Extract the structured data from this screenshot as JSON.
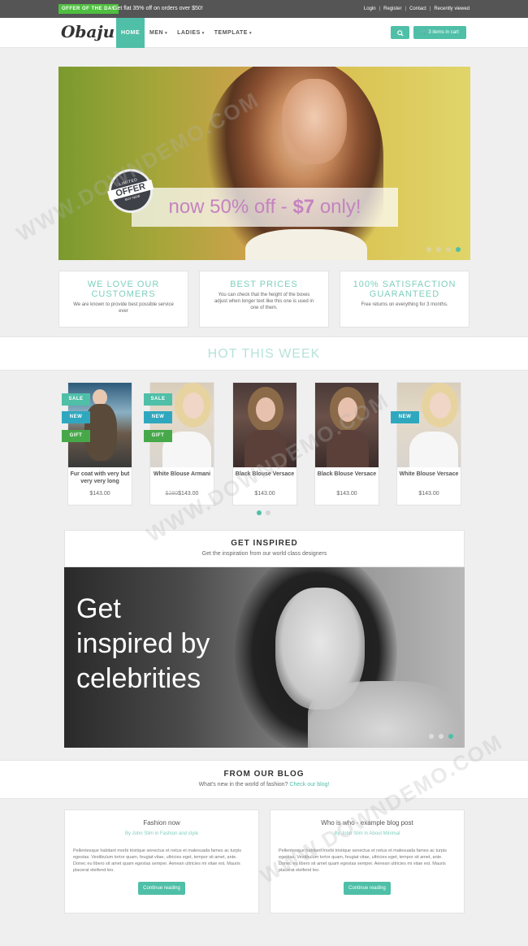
{
  "topbar": {
    "offer_badge": "OFFER OF THE DAY",
    "offer_text": "Get flat 35% off on orders over $50!",
    "links": [
      "Login",
      "Register",
      "Contact",
      "Recently viewed"
    ]
  },
  "nav": {
    "logo": "Obaju",
    "items": [
      {
        "label": "HOME",
        "caret": ""
      },
      {
        "label": "MEN",
        "caret": "▾"
      },
      {
        "label": "LADIES",
        "caret": "▾"
      },
      {
        "label": "TEMPLATE",
        "caret": "▾"
      }
    ],
    "search_icon": "🔍",
    "cart_label": "🛒 3 items in cart"
  },
  "hero": {
    "badge_top": "LIMITED",
    "badge_mid": "OFFER",
    "badge_bottom": "BUY NOW",
    "text_pre": "now 50% off - ",
    "text_strong": "$7",
    "text_post": " only!"
  },
  "features": [
    {
      "title": "WE LOVE OUR CUSTOMERS",
      "desc": "We are known to provide best possible service ever"
    },
    {
      "title": "BEST PRICES",
      "desc": "You can check that the height of the boxes adjust when longer text like this one is used in one of them."
    },
    {
      "title": "100% SATISFACTION GUARANTEED",
      "desc": "Free returns on everything for 3 months."
    }
  ],
  "hot": {
    "title": "HOT THIS WEEK"
  },
  "products": [
    {
      "name": "Fur coat with very but very very long",
      "old_price": "",
      "price": "$143.00",
      "ribbons": [
        "SALE",
        "NEW",
        "GIFT"
      ]
    },
    {
      "name": "White Blouse Armani",
      "old_price": "$280",
      "price": "$143.00",
      "ribbons": [
        "SALE",
        "NEW",
        "GIFT"
      ]
    },
    {
      "name": "Black Blouse Versace",
      "old_price": "",
      "price": "$143.00",
      "ribbons": []
    },
    {
      "name": "Black Blouse Versace",
      "old_price": "",
      "price": "$143.00",
      "ribbons": []
    },
    {
      "name": "White Blouse Versace",
      "old_price": "",
      "price": "$143.00",
      "ribbons": [
        "NEW"
      ]
    }
  ],
  "inspired": {
    "title": "GET INSPIRED",
    "subtitle": "Get the inspiration from our world class designers",
    "image_text": "Get inspired by celebrities"
  },
  "blog": {
    "title": "FROM OUR BLOG",
    "subtitle_pre": "What's new in the world of fashion? ",
    "subtitle_link": "Check our blog!",
    "posts": [
      {
        "title": "Fashion now",
        "byline": "By John Slim in Fashion and style",
        "excerpt": "Pellentesque habitant morbi tristique senectus et netus et malesuada fames ac turpis egestas. Vestibulum tortor quam, feugiat vitae, ultricies eget, tempor sit amet, ante. Donec eu libero sit amet quam egestas semper. Aenean ultricies mi vitae est. Mauris placerat eleifend leo.",
        "button": "Continue reading"
      },
      {
        "title": "Who is who - example blog post",
        "byline": "By John Slim in About Minimal",
        "excerpt": "Pellentesque habitant morbi tristique senectus et netus et malesuada fames ac turpis egestas. Vestibulum tortor quam, feugiat vitae, ultricies eget, tempor sit amet, ante. Donec eu libero sit amet quam egestas semper. Aenean ultricies mi vitae est. Mauris placerat eleifend leo.",
        "button": "Continue reading"
      }
    ]
  },
  "watermark": "WWW.DOWNDEMO.COM",
  "colors": {
    "accent": "#4fbfa8",
    "offer_green": "#4fbf40",
    "topbar": "#555555",
    "hero_text": "#c483c0"
  }
}
